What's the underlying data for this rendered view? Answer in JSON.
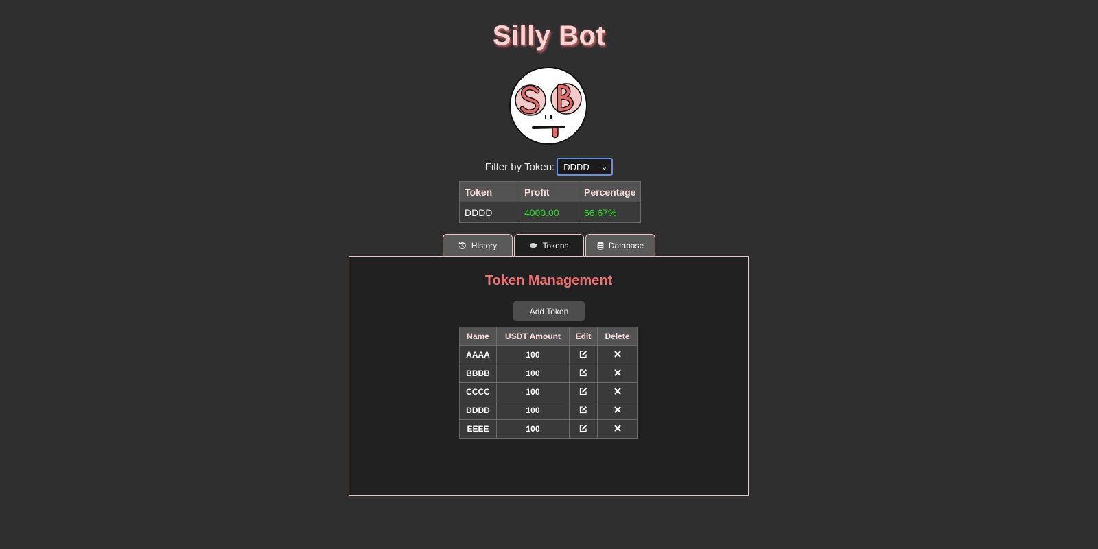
{
  "app": {
    "title": "Silly Bot"
  },
  "filter": {
    "label": "Filter by Token:",
    "selected": "DDDD"
  },
  "summary": {
    "headers": [
      "Token",
      "Profit",
      "Percentage"
    ],
    "row": {
      "token": "DDDD",
      "profit": "4000.00",
      "percentage": "66.67%"
    },
    "positive_color": "#22dd22"
  },
  "tabs": [
    {
      "label": "History",
      "icon": "history-icon",
      "active": false
    },
    {
      "label": "Tokens",
      "icon": "coins-icon",
      "active": true
    },
    {
      "label": "Database",
      "icon": "database-icon",
      "active": false
    }
  ],
  "token_management": {
    "title": "Token Management",
    "add_button": "Add Token",
    "headers": [
      "Name",
      "USDT Amount",
      "Edit",
      "Delete"
    ],
    "rows": [
      {
        "name": "AAAA",
        "amount": "100"
      },
      {
        "name": "BBBB",
        "amount": "100"
      },
      {
        "name": "CCCC",
        "amount": "100"
      },
      {
        "name": "DDDD",
        "amount": "100"
      },
      {
        "name": "EEEE",
        "amount": "100"
      }
    ],
    "edit_icon": "edit-icon",
    "delete_icon": "close-icon"
  },
  "colors": {
    "accent": "#f07070",
    "background": "#2f2f2f",
    "panel": "#212121"
  }
}
